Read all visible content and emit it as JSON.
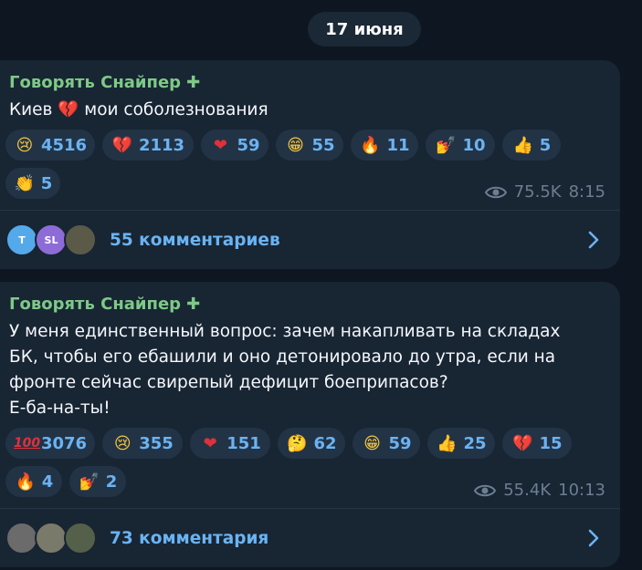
{
  "date_label": "17 июня",
  "accent": "#6ab3f3",
  "author_color": "#7ec987",
  "posts": [
    {
      "author": "Говорять Снайпер",
      "author_badge": "✚",
      "text": "Киев 💔 мои соболезнования",
      "reactions": [
        {
          "emoji": "😢",
          "icon": "crying-face-icon",
          "count": "4516"
        },
        {
          "emoji": "💔",
          "icon": "broken-heart-icon",
          "count": "2113"
        },
        {
          "emoji": "❤",
          "icon": "red-heart-icon",
          "count": "59"
        },
        {
          "emoji": "😁",
          "icon": "grinning-face-icon",
          "count": "55"
        },
        {
          "emoji": "🔥",
          "icon": "fire-icon",
          "count": "11"
        },
        {
          "emoji": "💅",
          "icon": "nail-polish-icon",
          "count": "10"
        },
        {
          "emoji": "👍",
          "icon": "thumbs-up-icon",
          "count": "5"
        },
        {
          "emoji": "👏",
          "icon": "clapping-hands-icon",
          "count": "5"
        }
      ],
      "views": "75.5K",
      "time": "8:15",
      "avatars": [
        {
          "label": "T",
          "color": "#54a9eb"
        },
        {
          "label": "SL",
          "color": "#8e6cd8"
        },
        {
          "label": "",
          "color": "#5b5a48"
        }
      ],
      "comments": "55 комментариев"
    },
    {
      "author": "Говорять Снайпер",
      "author_badge": "✚",
      "text": "У меня единственный вопрос: зачем накапливать на складах\nБК, чтобы его ебашили и оно детонировало до утра, если на\nфронте сейчас свирепый дефицит боеприпасов?\nЕ-ба-на-ты!",
      "reactions": [
        {
          "emoji": "100",
          "icon": "hundred-points-icon",
          "count": "3076"
        },
        {
          "emoji": "😢",
          "icon": "crying-face-icon",
          "count": "355"
        },
        {
          "emoji": "❤",
          "icon": "red-heart-icon",
          "count": "151"
        },
        {
          "emoji": "🤔",
          "icon": "thinking-face-icon",
          "count": "62"
        },
        {
          "emoji": "😁",
          "icon": "grinning-face-icon",
          "count": "59"
        },
        {
          "emoji": "👍",
          "icon": "thumbs-up-icon",
          "count": "25"
        },
        {
          "emoji": "💔",
          "icon": "broken-heart-icon",
          "count": "15"
        },
        {
          "emoji": "🔥",
          "icon": "fire-icon",
          "count": "4"
        },
        {
          "emoji": "💅",
          "icon": "nail-polish-icon",
          "count": "2"
        }
      ],
      "views": "55.4K",
      "time": "10:13",
      "avatars": [
        {
          "label": "",
          "color": "#6b6b6b"
        },
        {
          "label": "",
          "color": "#7a7a6a"
        },
        {
          "label": "",
          "color": "#55604a"
        }
      ],
      "comments": "73 комментария"
    }
  ]
}
